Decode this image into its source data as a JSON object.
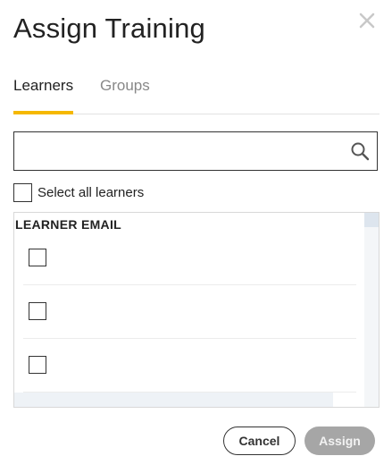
{
  "dialog": {
    "title": "Assign Training",
    "close_icon": "close-icon"
  },
  "tabs": [
    {
      "label": "Learners",
      "active": true
    },
    {
      "label": "Groups",
      "active": false
    }
  ],
  "search": {
    "value": "",
    "placeholder": "",
    "icon": "search-icon"
  },
  "select_all": {
    "label": "Select all learners",
    "checked": false
  },
  "list": {
    "header": "LEARNER EMAIL",
    "rows": [
      {
        "checked": false,
        "line1": "",
        "line2": ""
      },
      {
        "checked": false,
        "line1": "",
        "line2": ""
      },
      {
        "checked": false,
        "line1": "",
        "line2": ""
      }
    ]
  },
  "actions": {
    "cancel_label": "Cancel",
    "assign_label": "Assign",
    "assign_enabled": false
  },
  "colors": {
    "tab_accent": "#f5b800",
    "assign_disabled_bg": "#a6a6a6",
    "text": "#222222"
  }
}
